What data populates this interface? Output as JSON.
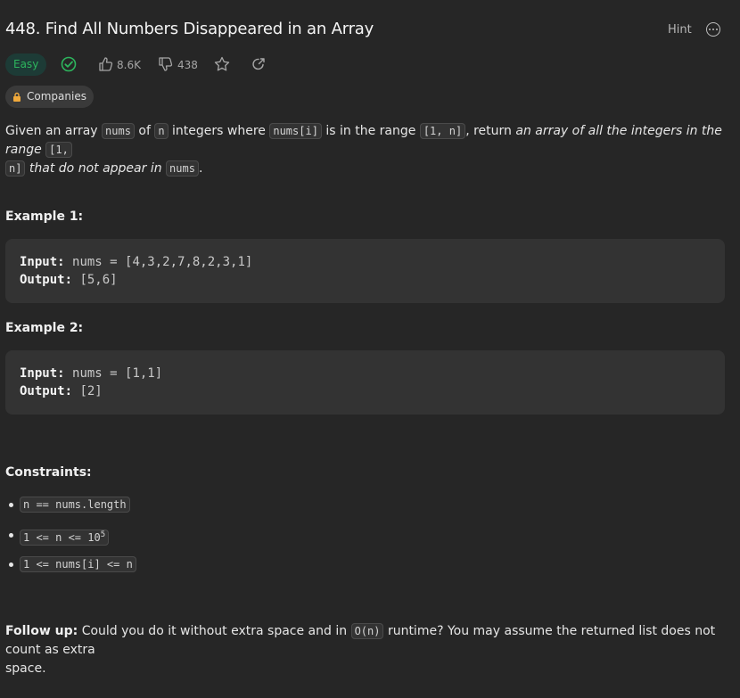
{
  "problem": {
    "number_title": "448. Find All Numbers Disappeared in an Array",
    "hint_label": "Hint",
    "difficulty": "Easy",
    "likes": "8.6K",
    "dislikes": "438",
    "companies_label": "Companies"
  },
  "description": {
    "p1": "Given an array",
    "c_nums": "nums",
    "p2": "of",
    "c_n": "n",
    "p3": "integers where",
    "c_numsi": "nums[i]",
    "p4": "is in the range",
    "c_range": "[1, n]",
    "p5": ", return",
    "em1": "an array of all the integers in the range",
    "c_range_a": "[1,",
    "c_range_b": "n]",
    "em2": "that do not appear in",
    "c_nums2": "nums",
    "p6": "."
  },
  "examples": [
    {
      "heading": "Example 1:",
      "input_label": "Input:",
      "input_value": "nums = [4,3,2,7,8,2,3,1]",
      "output_label": "Output:",
      "output_value": "[5,6]"
    },
    {
      "heading": "Example 2:",
      "input_label": "Input:",
      "input_value": "nums = [1,1]",
      "output_label": "Output:",
      "output_value": "[2]"
    }
  ],
  "constraints": {
    "heading": "Constraints:",
    "items": [
      {
        "text": "n == nums.length"
      },
      {
        "text": "1 <= n <= 10",
        "sup": "5"
      },
      {
        "text": "1 <= nums[i] <= n"
      }
    ]
  },
  "follow_up": {
    "label": "Follow up:",
    "text1": "Could you do it without extra space and in",
    "code": "O(n)",
    "text2": "runtime? You may assume the returned list does not count as extra",
    "text3": "space."
  },
  "colors": {
    "easy": "#2db55d",
    "background": "#262626",
    "code_bg": "#333333"
  }
}
